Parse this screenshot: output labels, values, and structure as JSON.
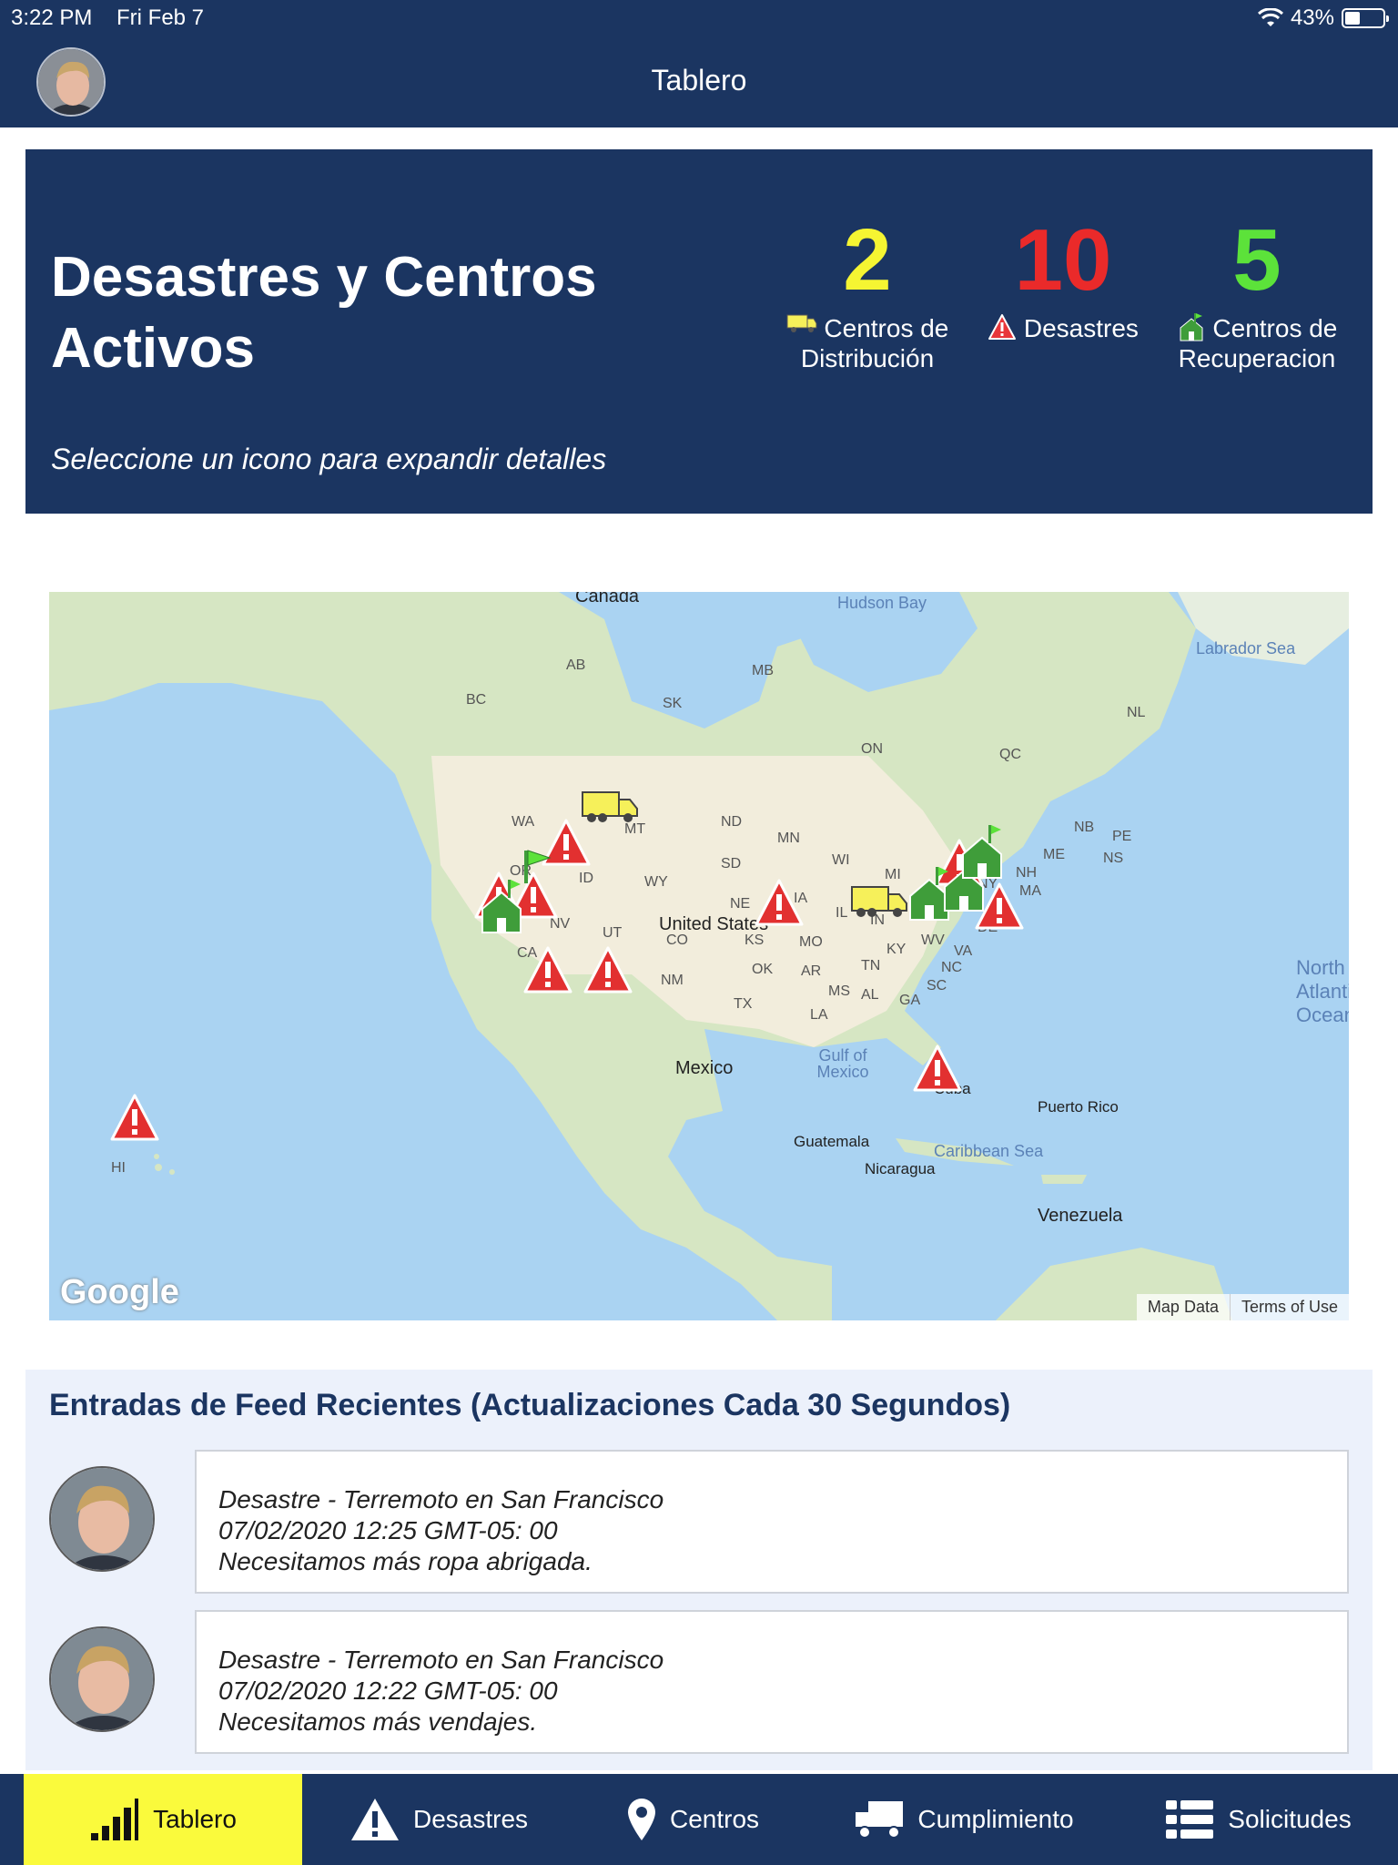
{
  "status_bar": {
    "time": "3:22 PM",
    "date": "Fri Feb 7",
    "battery": "43%"
  },
  "nav": {
    "title": "Tablero"
  },
  "hero": {
    "title": "Desastres y Centros Activos",
    "subtitle": "Seleccione un icono para expandir detalles",
    "stats": {
      "distribution": {
        "value": "2",
        "label": "Centros de Distribución",
        "color": "#f5f532",
        "icon": "truck-icon"
      },
      "disasters": {
        "value": "10",
        "label": "Desastres",
        "color": "#ea2a2a",
        "icon": "warning-icon"
      },
      "recovery": {
        "value": "5",
        "label": "Centros de Recuperacion",
        "color": "#5ce23a",
        "icon": "house-icon"
      }
    }
  },
  "map": {
    "labels": {
      "canada": "Canada",
      "hudson_bay": "Hudson Bay",
      "labrador_sea": "Labrador Sea",
      "ab": "AB",
      "mb": "MB",
      "bc": "BC",
      "sk": "SK",
      "on": "ON",
      "qc": "QC",
      "nl": "NL",
      "nb": "NB",
      "pe": "PE",
      "ns": "NS",
      "me": "ME",
      "nh": "NH",
      "ma": "MA",
      "ny": "NY",
      "wa": "WA",
      "mt": "MT",
      "nd": "ND",
      "mn": "MN",
      "or": "OR",
      "id": "ID",
      "sd": "SD",
      "wi": "WI",
      "mi": "MI",
      "wy": "WY",
      "ne": "NE",
      "ia": "IA",
      "il": "IL",
      "in": "IN",
      "nv": "NV",
      "ut": "UT",
      "co": "CO",
      "ks": "KS",
      "mo": "MO",
      "ky": "KY",
      "wv": "WV",
      "va": "VA",
      "de": "DE",
      "ca": "CA",
      "ok": "OK",
      "ar": "AR",
      "tn": "TN",
      "nc": "NC",
      "nm": "NM",
      "tx": "TX",
      "ms": "MS",
      "al": "AL",
      "ga": "GA",
      "sc": "SC",
      "la": "LA",
      "usa": "United States",
      "north_atlantic": "North Atlantic Ocean",
      "mexico": "Mexico",
      "gulf": "Gulf of Mexico",
      "cuba": "Cuba",
      "puerto_rico": "Puerto Rico",
      "guatemala": "Guatemala",
      "caribbean": "Caribbean Sea",
      "nicaragua": "Nicaragua",
      "venezuela": "Venezuela",
      "hi": "HI"
    },
    "logo": "Google",
    "footer": {
      "map_data": "Map Data",
      "terms": "Terms of Use"
    }
  },
  "feed": {
    "title": "Entradas de Feed Recientes (Actualizaciones Cada 30 Segundos)",
    "entries": [
      {
        "line1": "Desastre - Terremoto en San Francisco",
        "line2": "07/02/2020 12:25 GMT-05: 00",
        "line3": "Necesitamos más ropa abrigada."
      },
      {
        "line1": "Desastre - Terremoto en San Francisco",
        "line2": "07/02/2020 12:22 GMT-05: 00",
        "line3": "Necesitamos más vendajes."
      }
    ]
  },
  "tabs": [
    {
      "label": "Tablero",
      "icon": "signal-bars-icon",
      "active": true
    },
    {
      "label": "Desastres",
      "icon": "warning-icon"
    },
    {
      "label": "Centros",
      "icon": "map-pin-icon"
    },
    {
      "label": "Cumplimiento",
      "icon": "truck-icon"
    },
    {
      "label": "Solicitudes",
      "icon": "list-icon"
    }
  ]
}
